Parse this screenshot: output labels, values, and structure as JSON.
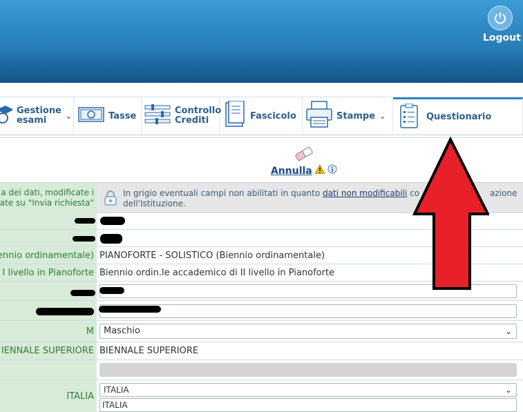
{
  "header": {
    "logout_label": "Logout"
  },
  "menu": {
    "items": [
      {
        "label1": "Gestione",
        "label2": "esami",
        "has_dropdown": true
      },
      {
        "label1": "Tasse",
        "label2": "",
        "has_dropdown": false
      },
      {
        "label1": "Controllo",
        "label2": "Crediti",
        "has_dropdown": false
      },
      {
        "label1": "Fascicolo",
        "label2": "",
        "has_dropdown": false
      },
      {
        "label1": "Stampe",
        "label2": "",
        "has_dropdown": true
      },
      {
        "label1": "Questionario",
        "label2": "",
        "has_dropdown": false
      }
    ]
  },
  "actions": {
    "annulla_label": "Annulla"
  },
  "notice": {
    "left_line1": "a dei dati, modificate i",
    "left_line2": "ate su \"Invia richiesta\"",
    "msg_line1_a": "In grigio eventuali campi non abilitati in quanto",
    "msg_line1_link": "dati non modificabili",
    "msg_line1_b": "co",
    "msg_line1_c": "azione",
    "msg_line2": "dell'Istituzione."
  },
  "form": {
    "corso_label": "iennio ordinamentale)",
    "corso_value": "PIANOFORTE - SOLISTICO (Biennio ordinamentale)",
    "livello_label": "I livello in Pianoforte",
    "livello_value": "Biennio ordin.le accademico di II livello in Pianoforte",
    "sesso_label": "M",
    "sesso_value": "Maschio",
    "biennale_label": "IENNALE SUPERIORE",
    "biennale_value": "BIENNALE SUPERIORE",
    "nazione_label": "ITALIA",
    "nazione_select": "ITALIA",
    "nazione_input": "ITALIA"
  },
  "colors": {
    "accent": "#2a86c9",
    "label_bg": "#d8ebd9",
    "label_text": "#2e7d32",
    "arrow": "#e8202a"
  }
}
